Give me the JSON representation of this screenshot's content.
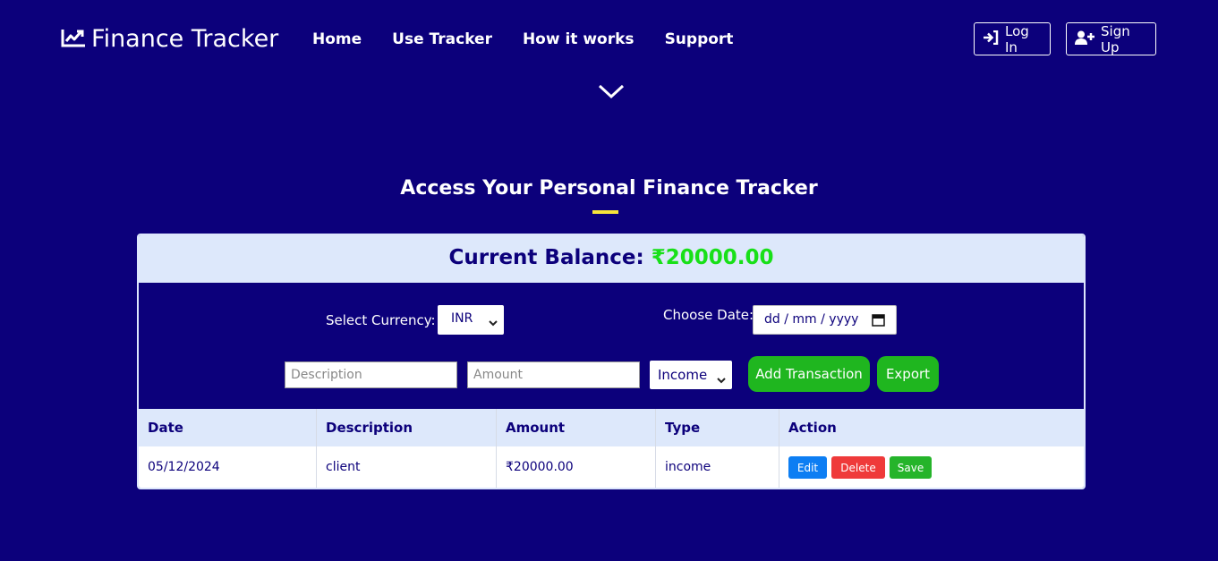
{
  "nav": {
    "brand": "Finance Tracker",
    "links": [
      "Home",
      "Use Tracker",
      "How it works",
      "Support"
    ],
    "login": "Log In",
    "signup": "Sign Up"
  },
  "hero": {
    "heading": "Access Your Personal Finance Tracker"
  },
  "balance": {
    "label": "Current Balance:",
    "value": "₹20000.00"
  },
  "form": {
    "currency_label": "Select Currency:",
    "currency_value": "INR",
    "date_label": "Choose Date:",
    "date_placeholder": "dd / mm / yyyy",
    "description_placeholder": "Description",
    "amount_placeholder": "Amount",
    "type_value": "Income",
    "add_button": "Add Transaction",
    "export_button": "Export"
  },
  "table": {
    "headers": [
      "Date",
      "Description",
      "Amount",
      "Type",
      "Action"
    ],
    "rows": [
      {
        "date": "05/12/2024",
        "description": "client",
        "amount": "₹20000.00",
        "type": "income"
      }
    ],
    "actions": {
      "edit": "Edit",
      "delete": "Delete",
      "save": "Save"
    }
  },
  "colors": {
    "background": "#0c007b",
    "accent_yellow": "#f7e53a",
    "balance_green": "#18e018",
    "button_green": "#1fb61f",
    "edit_blue": "#0d7ef3",
    "delete_red": "#ef3a3a",
    "save_green": "#25b42a"
  },
  "icons": [
    "chart-line-icon",
    "login-icon",
    "user-plus-icon",
    "chevron-down-icon",
    "calendar-icon"
  ]
}
